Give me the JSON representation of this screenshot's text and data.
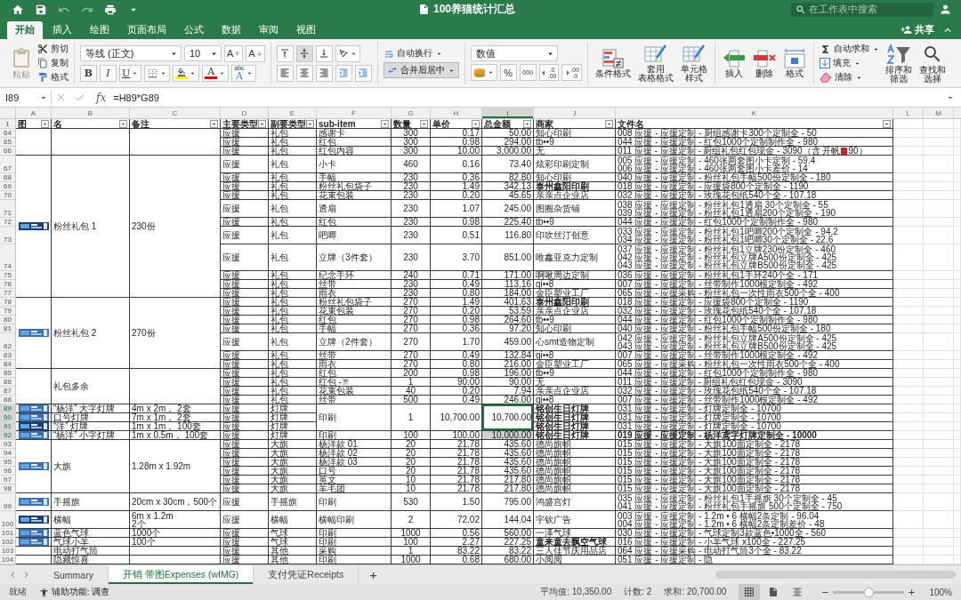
{
  "title_bar": {
    "title": "100养猫统计汇总",
    "search_placeholder": "在工作表中搜索",
    "quick_access": [
      {
        "kind": "home",
        "disabled": false
      },
      {
        "kind": "save",
        "disabled": false
      },
      {
        "kind": "undo",
        "disabled": true
      },
      {
        "kind": "redo",
        "disabled": true
      },
      {
        "kind": "print",
        "disabled": false
      },
      {
        "kind": "customize",
        "disabled": false
      }
    ]
  },
  "ribbon_tabs": [
    {
      "label": "开始",
      "selected": true
    },
    {
      "label": "插入",
      "selected": false
    },
    {
      "label": "绘图",
      "selected": false
    },
    {
      "label": "页面布局",
      "selected": false
    },
    {
      "label": "公式",
      "selected": false
    },
    {
      "label": "数据",
      "selected": false
    },
    {
      "label": "审阅",
      "selected": false
    },
    {
      "label": "视图",
      "selected": false
    }
  ],
  "share": "共享",
  "ribbon": {
    "paste": {
      "label": "粘贴",
      "disabled": true
    },
    "clipboard": [
      {
        "kind": "cut",
        "label": "剪切"
      },
      {
        "kind": "copy",
        "label": "复制"
      },
      {
        "kind": "format_painter",
        "label": "格式"
      }
    ],
    "font_name": "等线 (正文)",
    "font_size": "10",
    "grow_font": "A",
    "shrink_font": "A",
    "bold": "B",
    "italic": "I",
    "underline": "U",
    "font_color_label": "A",
    "phonetic": {
      "top": "abc",
      "bottom": "A"
    },
    "vertical_align": [
      {
        "selected": false
      },
      {
        "selected": true
      },
      {
        "selected": false
      }
    ],
    "wrap": "自动换行",
    "merge": {
      "label": "合并后居中",
      "selected": true
    },
    "number_format": "数值",
    "percent": "%",
    "thousands": "000",
    "decimals": [
      {
        "top": ".0",
        "bottom": ".00"
      },
      {
        "top": ".00",
        "bottom": ".0"
      }
    ],
    "styles": [
      {
        "kind": "conditional",
        "label": [
          "条件格式"
        ]
      },
      {
        "kind": "table",
        "label": [
          "套用",
          "表格格式"
        ]
      },
      {
        "kind": "cell",
        "label": [
          "单元格",
          "样式"
        ]
      }
    ],
    "cells": [
      {
        "kind": "insert",
        "label": "插入"
      },
      {
        "kind": "delete",
        "label": "删除"
      },
      {
        "kind": "format",
        "label": "格式"
      }
    ],
    "editing": [
      {
        "kind": "sum",
        "label": "自动求和"
      },
      {
        "kind": "fill",
        "label": "填充"
      },
      {
        "kind": "clear",
        "label": "清除"
      }
    ],
    "sort": [
      "排序和",
      "筛选"
    ],
    "find": [
      "查找和",
      "选择"
    ]
  },
  "formula_bar": {
    "name_box": "I89",
    "function_label": "fx",
    "formula": "=H89*G89"
  },
  "sheet": {
    "columns": [
      {
        "letter": "A",
        "selected": false
      },
      {
        "letter": "B",
        "selected": false
      },
      {
        "letter": "C",
        "selected": false
      },
      {
        "letter": "D",
        "selected": false
      },
      {
        "letter": "E",
        "selected": false
      },
      {
        "letter": "F",
        "selected": false
      },
      {
        "letter": "G",
        "selected": false
      },
      {
        "letter": "H",
        "selected": false
      },
      {
        "letter": "I",
        "selected": true
      },
      {
        "letter": "J",
        "selected": false
      },
      {
        "letter": "K",
        "selected": false
      },
      {
        "letter": "L",
        "selected": false
      },
      {
        "letter": "M",
        "selected": false
      }
    ],
    "header": {
      "n": "1",
      "cells": {
        "a": "图",
        "b": "名",
        "c": "备注",
        "d": "主要类型",
        "e": "副要类型",
        "f": "sub-item",
        "g": "数量",
        "h": "单价",
        "i": "总金额",
        "j": "商家",
        "k": "文件名"
      }
    },
    "groups": [
      {
        "picture": false,
        "rows": [
          {
            "n": "64",
            "selected": false,
            "cells": {
              "d": "应援",
              "e": "礼包",
              "f": "感谢卡",
              "g": "300",
              "h": "0.17",
              "i": "50.00",
              "j": "知心印刷",
              "k": [
                "008 应援 - 应援定制 - 厨组感谢卡300个定制全 - 50"
              ]
            }
          },
          {
            "n": "65",
            "selected": false,
            "cells": {
              "d": "应援",
              "e": "礼包",
              "f": "红包",
              "g": "300",
              "h": "0.98",
              "i": "294.00",
              "j": "tb••9",
              "k": [
                "044 应援 - 应援定制 - 红包1000个定制制作全 - 980"
              ]
            }
          },
          {
            "n": "66",
            "selected": false,
            "marked_tail": "90）",
            "cells": {
              "d": "应援",
              "e": "礼包",
              "f": "红包内容",
              "g": "300",
              "h": "10.00",
              "i": "3,000.00",
              "j": "无",
              "k": [
                "011 应援 - 应援定制 - 厨组礼包红包现金 - 3090（含 开帆"
              ]
            }
          }
        ]
      },
      {
        "picture": true,
        "name": "粉丝礼包 1",
        "note": "230份",
        "rows": [
          {
            "n": "67",
            "selected": false,
            "cells": {
              "d": "应援",
              "e": "礼包",
              "f": "小卡",
              "g": "460",
              "h": "0.16",
              "i": "73.40",
              "j": "炫彩印刷定制",
              "k": [
                "005 应援 - 应援定制 - 460张两套图小卡定制 - 59.4",
                "006 应援 - 应援定制 - 460张两套图小卡差价 - 14"
              ]
            }
          },
          {
            "n": "68",
            "selected": false,
            "cells": {
              "d": "应援",
              "e": "礼包",
              "f": "手幅",
              "g": "230",
              "h": "0.36",
              "i": "82.80",
              "j": "知心印刷",
              "k": [
                "040 应援 - 应援定制 - 粉丝礼包手幅500份定制全 - 180"
              ]
            }
          },
          {
            "n": "69",
            "selected": false,
            "bold": {
              "j": true
            },
            "cells": {
              "d": "应援",
              "e": "礼包",
              "f": "粉丝礼包袋子",
              "g": "230",
              "h": "1.49",
              "i": "342.13",
              "j": "泰州鑫阳印刷",
              "k": [
                "018 应援 - 应援定制 - 应援袋800个定制全 - 1190"
              ]
            }
          },
          {
            "n": "70",
            "selected": false,
            "cells": {
              "d": "应援",
              "e": "礼包",
              "f": "花束包装",
              "g": "230",
              "h": "0.20",
              "i": "45.65",
              "j": "亲亲点企业店",
              "k": [
                "032 应援 - 应援定制 - 玫瑰花包纸540个全 - 107.18"
              ]
            }
          },
          {
            "n": "71",
            "selected": false,
            "cells": {
              "d": "应援",
              "e": "礼包",
              "f": "透扇",
              "g": "230",
              "h": "1.07",
              "i": "245.00",
              "j": "图圈杂货铺",
              "k": [
                "038 应援 - 应援定制 - 粉丝礼包1透扇 30个定制全 - 55",
                "039 应援 - 应援定制 - 粉丝礼包1透扇200个定制全 - 190"
              ]
            }
          },
          {
            "n": "72",
            "selected": false,
            "cells": {
              "d": "应援",
              "e": "礼包",
              "f": "红包",
              "g": "230",
              "h": "0.98",
              "i": "225.40",
              "j": "tb••9",
              "k": [
                "044 应援 - 应援定制 - 红包1000个定制制作全 - 980"
              ]
            }
          },
          {
            "n": "73",
            "selected": false,
            "cells": {
              "d": "应援",
              "e": "礼包",
              "f": "吧唧",
              "g": "230",
              "h": "0.51",
              "i": "116.80",
              "j": "印吹丝汀创意",
              "k": [
                "033 应援 - 应援定制 - 粉丝礼包1吧唧200个定制全 - 94.2",
                "034 应援 - 应援定制 - 粉丝礼包1吧唧30个定制全 - 22.6"
              ]
            }
          },
          {
            "n": "74",
            "selected": false,
            "cells": {
              "d": "应援",
              "e": "礼包",
              "f": "立牌（3件套）",
              "g": "230",
              "h": "3.70",
              "i": "851.00",
              "j": "唯鑫亚克力定制",
              "k": [
                "037 应援 - 应援定制 - 粉丝礼包1立牌230份定制全 - 460",
                "042 应援 - 应援定制 - 粉丝礼包立牌A500份定制全 - 425",
                "043 应援 - 应援定制 - 粉丝礼包立牌B500份定制全 - 425"
              ]
            }
          },
          {
            "n": "75",
            "selected": false,
            "cells": {
              "d": "应援",
              "e": "礼包",
              "f": "纪念手环",
              "g": "240",
              "h": "0.71",
              "i": "171.00",
              "j": "啊啾周边定制",
              "k": [
                "036 应援 - 应援定制 - 粉丝礼包1手环240个全 - 171"
              ]
            }
          },
          {
            "n": "76",
            "selected": false,
            "cells": {
              "d": "应援",
              "e": "礼包",
              "f": "丝带",
              "g": "230",
              "h": "0.49",
              "i": "113.16",
              "j": "qi••8",
              "k": [
                "007 应援 - 应援定制 - 丝带制作1000根定制全 - 492"
              ]
            }
          },
          {
            "n": "77",
            "selected": false,
            "cells": {
              "d": "应援",
              "e": "礼包",
              "f": "雨衣",
              "g": "230",
              "h": "0.80",
              "i": "184.00",
              "j": "金臣塑业工厂",
              "k": [
                "065 应援 - 应援采购 - 粉丝礼包一次性雨衣500个全 - 400"
              ]
            }
          }
        ]
      },
      {
        "picture": true,
        "name": "粉丝礼包 2",
        "note": "270份",
        "rows": [
          {
            "n": "78",
            "selected": false,
            "bold": {
              "j": true
            },
            "cells": {
              "d": "应援",
              "e": "礼包",
              "f": "粉丝礼包袋子",
              "g": "270",
              "h": "1.49",
              "i": "401.63",
              "j": "泰州鑫阳印刷",
              "k": [
                "018 应援 - 应援定制 - 应援袋800个定制全 - 1190"
              ]
            }
          },
          {
            "n": "79",
            "selected": false,
            "cells": {
              "d": "应援",
              "e": "礼包",
              "f": "花束包装",
              "g": "270",
              "h": "0.20",
              "i": "53.59",
              "j": "亲亲点企业店",
              "k": [
                "032 应援 - 应援定制 - 玫瑰花包纸540个全 - 107.18"
              ]
            }
          },
          {
            "n": "80",
            "selected": false,
            "cells": {
              "d": "应援",
              "e": "礼包",
              "f": "红包",
              "g": "270",
              "h": "0.98",
              "i": "264.60",
              "j": "tb••9",
              "k": [
                "044 应援 - 应援定制 - 红包1000个定制制作全 - 980"
              ]
            }
          },
          {
            "n": "81",
            "selected": false,
            "cells": {
              "d": "应援",
              "e": "礼包",
              "f": "手幅",
              "g": "270",
              "h": "0.36",
              "i": "97.20",
              "j": "知心印刷",
              "k": [
                "040 应援 - 应援定制 - 粉丝礼包手幅500份定制全 - 180"
              ]
            }
          },
          {
            "n": "82",
            "selected": false,
            "cells": {
              "d": "应援",
              "e": "礼包",
              "f": "立牌（2件套）",
              "g": "270",
              "h": "1.70",
              "i": "459.00",
              "j": "心smt造物定制",
              "k": [
                "042 应援 - 应援定制 - 粉丝礼包立牌A500份定制全 - 425",
                "043 应援 - 应援定制 - 粉丝礼包立牌B500份定制全 - 425"
              ]
            }
          },
          {
            "n": "83",
            "selected": false,
            "cells": {
              "d": "应援",
              "e": "礼包",
              "f": "丝带",
              "g": "270",
              "h": "0.49",
              "i": "132.84",
              "j": "qi••8",
              "k": [
                "007 应援 - 应援定制 - 丝带制作1000根定制全 - 492"
              ]
            }
          },
          {
            "n": "84",
            "selected": false,
            "cells": {
              "d": "应援",
              "e": "礼包",
              "f": "雨衣",
              "g": "270",
              "h": "0.80",
              "i": "216.00",
              "j": "金臣塑业工厂",
              "k": [
                "065 应援 - 应援采购 - 粉丝礼包一次性雨衣500个全 - 400"
              ]
            }
          }
        ]
      },
      {
        "picture": false,
        "name": "礼包多余",
        "rows": [
          {
            "n": "85",
            "selected": false,
            "cells": {
              "d": "应援",
              "e": "礼包",
              "f": "红包",
              "g": "200",
              "h": "0.98",
              "i": "196.00",
              "j": "tb••9",
              "k": [
                "044 应援 - 应援定制 - 红包1000个定制制作全 - 980"
              ]
            }
          },
          {
            "n": "86",
            "selected": false,
            "icon_after": {
              "f": true
            },
            "cells": {
              "d": "应援",
              "e": "礼包",
              "f": "红包 -",
              "g": "1",
              "h": "90.00",
              "i": "90.00",
              "j": "无",
              "k": [
                "011 应援 - 应援定制 - 厨组礼包红包现金 - 3090"
              ]
            }
          },
          {
            "n": "87",
            "selected": false,
            "cells": {
              "d": "应援",
              "e": "礼包",
              "f": "花束包装",
              "g": "40",
              "h": "0.20",
              "i": "7.94",
              "j": "亲亲点企业店",
              "k": [
                "032 应援 - 应援定制 - 玫瑰花包纸540个全 - 107.18"
              ]
            }
          },
          {
            "n": "88",
            "selected": false,
            "cells": {
              "d": "应援",
              "e": "礼包",
              "f": "丝带",
              "g": "500",
              "h": "0.49",
              "i": "246.00",
              "j": "qi••8",
              "k": [
                "007 应援 - 应援定制 - 丝带制作1000根定制全 - 492"
              ]
            }
          }
        ]
      },
      {
        "picture": true,
        "name": "“杨洋” 大字灯牌",
        "note": "4m x 2m，  2套",
        "rows": [
          {
            "n": "89",
            "selected": true,
            "active_cell": true,
            "bold": {
              "j": true
            },
            "cells": {
              "d": "应援",
              "e": "灯牌",
              "f": "印刷",
              "g": "1",
              "h": "10,700.00",
              "i": "10,700.00",
              "j": "铭创生日灯牌",
              "k": [
                "031 应援 - 应援定制 - 灯牌定制全 - 10700"
              ]
            }
          }
        ]
      },
      {
        "picture": true,
        "name": "口号灯牌",
        "note": "7m x 1m，  2套",
        "rows": [
          {
            "n": "90",
            "selected": true,
            "bold": {
              "j": true
            },
            "cells": {
              "d": "应援",
              "e": "灯牌",
              "j": "铭创生日灯牌",
              "k": [
                "031 应援 - 应援定制 - 灯牌定制全 - 10700"
              ]
            }
          }
        ]
      },
      {
        "picture": true,
        "name": "“洋” 灯牌",
        "note": "1m x 1m，  100套",
        "rows": [
          {
            "n": "91",
            "selected": true,
            "bold": {
              "j": true
            },
            "cells": {
              "d": "应援",
              "e": "灯牌",
              "j": "铭创生日灯牌",
              "k": [
                "031 应援 - 应援定制 - 灯牌定制全 - 10700"
              ]
            }
          }
        ]
      },
      {
        "picture": true,
        "name": "“杨洋” 小字灯牌",
        "note": "1m x 0.5m，  100套",
        "rows": [
          {
            "n": "92",
            "selected": true,
            "range_cell": true,
            "bold": {
              "j": true,
              "k": true
            },
            "cells": {
              "d": "应援",
              "e": "灯牌",
              "f": "印刷",
              "g": "100",
              "h": "100.00",
              "i": "10,000.00",
              "j": "铭创生日灯牌",
              "k": [
                "019 应援 - 应援定制 - 杨洋鸢字灯牌定制全 - 10000"
              ]
            }
          }
        ]
      },
      {
        "picture": true,
        "name": "大旗",
        "note": "1.28m x 1.92m",
        "rows": [
          {
            "n": "93",
            "selected": false,
            "cells": {
              "d": "应援",
              "e": "大旗",
              "f": "杨洋款 01",
              "g": "20",
              "h": "21.78",
              "i": "435.60",
              "j": "德尚旗帜",
              "k": [
                "015 应援 - 应援定制 - 大旗100面定制全 - 2178"
              ]
            }
          },
          {
            "n": "94",
            "selected": false,
            "cells": {
              "d": "应援",
              "e": "大旗",
              "f": "杨洋款 02",
              "g": "20",
              "h": "21.78",
              "i": "435.60",
              "j": "德尚旗帜",
              "k": [
                "015 应援 - 应援定制 - 大旗100面定制全 - 2178"
              ]
            }
          },
          {
            "n": "95",
            "selected": false,
            "cells": {
              "d": "应援",
              "e": "大旗",
              "f": "杨洋款 03",
              "g": "20",
              "h": "21.78",
              "i": "435.60",
              "j": "德尚旗帜",
              "k": [
                "015 应援 - 应援定制 - 大旗100面定制全 - 2178"
              ]
            }
          },
          {
            "n": "96",
            "selected": false,
            "cells": {
              "d": "应援",
              "e": "大旗",
              "f": "口号",
              "g": "20",
              "h": "21.78",
              "i": "435.60",
              "j": "德尚旗帜",
              "k": [
                "015 应援 - 应援定制 - 大旗100面定制全 - 2178"
              ]
            }
          },
          {
            "n": "97",
            "selected": false,
            "cells": {
              "d": "应援",
              "e": "大旗",
              "f": "英文",
              "g": "10",
              "h": "21.78",
              "i": "217.80",
              "j": "德尚旗帜",
              "k": [
                "015 应援 - 应援定制 - 大旗100面定制全 - 2178"
              ]
            }
          },
          {
            "n": "98",
            "selected": false,
            "cells": {
              "d": "应援",
              "e": "大旗",
              "f": "羊毛团",
              "g": "10",
              "h": "21.78",
              "i": "217.80",
              "j": "德尚旗帜",
              "k": [
                "015 应援 - 应援定制 - 大旗100面定制全 - 2178"
              ]
            }
          }
        ]
      },
      {
        "picture": true,
        "name": "手摇旗",
        "note": "20cm x 30cm，500个",
        "rows": [
          {
            "n": "99",
            "selected": false,
            "cells": {
              "d": "应援",
              "e": "手摇旗",
              "f": "印刷",
              "g": "530",
              "h": "1.50",
              "i": "795.00",
              "j": "鸿盛宫灯",
              "k": [
                "035 应援 - 应援定制 - 粉丝礼包1手摇旗 30个定制全 - 45",
                "041 应援 - 应援定制 - 粉丝礼包手摇旗 500个定制全 - 750"
              ]
            }
          }
        ]
      },
      {
        "picture": true,
        "name": "横幅",
        "note": [
          "6m x 1.2m",
          "2个"
        ],
        "rows": [
          {
            "n": "100",
            "selected": false,
            "cells": {
              "d": "应援",
              "e": "横幅",
              "f": "横幅印刷",
              "g": "2",
              "h": "72.02",
              "i": "144.04",
              "j": "宇钦广告",
              "k": [
                "003 应援 - 应援定制 - 1.2m • 6 横幅2条定制 - 96.04",
                "004 应援 - 应援定制 - 1.2m • 6 横幅2条定制差价 - 48"
              ]
            }
          }
        ]
      },
      {
        "picture": true,
        "name": "蓝色气球",
        "note": "1000个",
        "rows": [
          {
            "n": "101",
            "selected": false,
            "cells": {
              "d": "应援",
              "e": "气球",
              "f": "印刷",
              "g": "1000",
              "h": "0.56",
              "i": "560.00",
              "j": "一泽气球",
              "k": [
                "030 应援 - 应援定制 - 气球定制3款蓝色•1000全 - 560"
              ]
            }
          }
        ]
      },
      {
        "picture": true,
        "name": "气球小羊",
        "note": "100个",
        "rows": [
          {
            "n": "102",
            "selected": false,
            "bold": {
              "j": true
            },
            "cells": {
              "d": "应援",
              "e": "气球",
              "f": "印刷",
              "g": "100",
              "h": "2.27",
              "i": "227.25",
              "j": "童来童去飘空气球",
              "k": [
                "016 应援 - 应援定制 - 小羊气球 x100全 - 227.25"
              ]
            }
          }
        ]
      },
      {
        "picture": false,
        "name": "电动打气筒",
        "rows": [
          {
            "n": "103",
            "selected": false,
            "cells": {
              "d": "应援",
              "e": "其他",
              "f": "采购",
              "g": "1",
              "h": "83.22",
              "i": "83.22",
              "j": "三人佳节庆用品店",
              "k": [
                "064 应援 - 应援采购 - 电动打气筒3个全 - 83.22"
              ]
            }
          }
        ]
      },
      {
        "picture": false,
        "name": "隐藏惊喜",
        "rows": [
          {
            "n": "104",
            "selected": false,
            "cells": {
              "d": "应援",
              "e": "其他",
              "f": "印刷",
              "g": "1000",
              "h": "0.68",
              "i": "680.00",
              "j": "小阅阅",
              "k": [
                "051 应援 - 应援定制 - 隐"
              ]
            }
          }
        ]
      }
    ]
  },
  "sheet_tabs": [
    {
      "label": "Summary",
      "selected": false
    },
    {
      "label": "开销 带图Expenses (wIMG)",
      "selected": true
    },
    {
      "label": "支付凭证Receipts",
      "selected": false
    }
  ],
  "add_sheet": "+",
  "status_bar": {
    "ready": "就绪",
    "accessibility": "辅助功能: 调查",
    "stats": [
      "平均值: 10,350.00",
      "计数: 2",
      "求和: 20,700.00"
    ],
    "views": [
      {
        "kind": "normal",
        "selected": true
      },
      {
        "kind": "page_layout",
        "selected": false
      },
      {
        "kind": "page_break",
        "selected": false
      }
    ],
    "zoom": {
      "level": 0.5,
      "label": "100%"
    }
  }
}
